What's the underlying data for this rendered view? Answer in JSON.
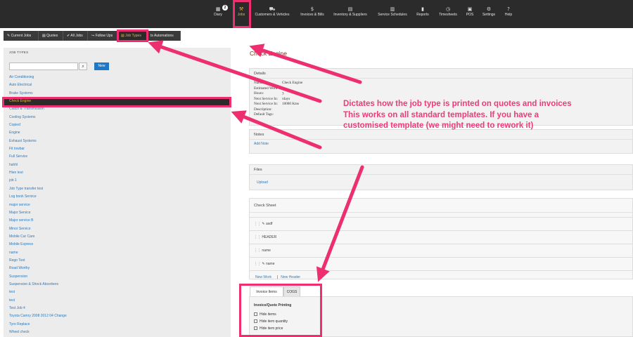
{
  "topnav": {
    "items": [
      {
        "label": "Diary",
        "icon": "calendar-icon",
        "glyph": "▦"
      },
      {
        "label": "Jobs",
        "icon": "wrench-icon",
        "glyph": "🔧"
      },
      {
        "label": "Customers & Vehicles",
        "icon": "car-icon",
        "glyph": "⛟"
      },
      {
        "label": "Invoices & Bills",
        "icon": "dollar-icon",
        "glyph": "$"
      },
      {
        "label": "Inventory & Suppliers",
        "icon": "box-icon",
        "glyph": "▤"
      },
      {
        "label": "Service Schedules",
        "icon": "print-icon",
        "glyph": "▥"
      },
      {
        "label": "Reports",
        "icon": "bar-chart-icon",
        "glyph": "▮"
      },
      {
        "label": "Timesheets",
        "icon": "clock-icon",
        "glyph": "◷"
      },
      {
        "label": "POS",
        "icon": "register-icon",
        "glyph": "▣"
      },
      {
        "label": "Settings",
        "icon": "gear-icon",
        "glyph": "⚙"
      },
      {
        "label": "Help",
        "icon": "help-icon",
        "glyph": "?"
      }
    ],
    "diary_badge": "2"
  },
  "subbar": {
    "items": [
      {
        "label": "✎ Current Jobs",
        "name": "current-jobs"
      },
      {
        "label": "▤ Quotes",
        "name": "quotes"
      },
      {
        "label": "✔ All Jobs",
        "name": "all-jobs"
      },
      {
        "label": "↪ Follow Ups",
        "name": "follow-ups"
      },
      {
        "label": "▤ Job Types",
        "name": "job-types"
      },
      {
        "label": "ts Automations",
        "name": "automations"
      }
    ]
  },
  "left_panel": {
    "title": "JOB TYPES",
    "search_value": "",
    "search_icon": "🔍",
    "new_button": "New",
    "items": [
      "Air Conditioning",
      "Auto Electrical",
      "Brake Systems",
      "Check Engine",
      "Clutch & Transmission",
      "Cooling Systems",
      "Copied",
      "Engine",
      "Exhaust Systems",
      "Fit towbar",
      "Full Service",
      "hahhl",
      "Hien test",
      "job 1",
      "Job Type transfer test",
      "Log book Service",
      "major service",
      "Major Service",
      "Major service B",
      "Minor Service",
      "Mobile Car Care",
      "Mobile Express",
      "name",
      "Rego Test",
      "Road Worthy",
      "Suspension",
      "Suspension & Shock Absorbers",
      "test",
      "test",
      "Test Job 4",
      "Toyota Camry 2008 2012 04 Change",
      "Tyre Replace",
      "Wheel check"
    ],
    "selected": "Check Engine"
  },
  "main": {
    "title": "Check Engine",
    "details": {
      "heading": "Details",
      "rows": [
        {
          "k": "Name:",
          "v": "Check Engine"
        },
        {
          "k": "Estimated Work Hours:",
          "v": "3"
        },
        {
          "k": "Next Service In:",
          "v": "rdays"
        },
        {
          "k": "Next Service In:",
          "v": "10000 Kms"
        },
        {
          "k": "Description:",
          "v": ""
        },
        {
          "k": "Default Tags:",
          "v": ""
        }
      ]
    },
    "notes": {
      "heading": "Notes",
      "link": "Add Note"
    },
    "files": {
      "heading": "Files",
      "link": "Upload"
    },
    "check_sheet": {
      "heading": "Check Sheet",
      "rows": [
        "⋮⋮ ✎ asdf",
        "⋮⋮ HEADER",
        "⋮⋮ name",
        "⋮⋮ ✎ name"
      ],
      "new_work": "New Work",
      "separator": "|",
      "new_header": "New Header"
    },
    "tabs": [
      "Invoice Items",
      "COGS"
    ],
    "invoice": {
      "heading": "Invoice/Quote Printing",
      "options": [
        "Hide items",
        "Hide item quantity",
        "Hide item price"
      ]
    }
  },
  "annotation": {
    "lines": [
      "Dictates how the job type is printed on quotes and invoices",
      "This works on all standard templates. If you have a",
      "customised template (we might need to rework it)"
    ],
    "color": "#ee2f6f"
  }
}
